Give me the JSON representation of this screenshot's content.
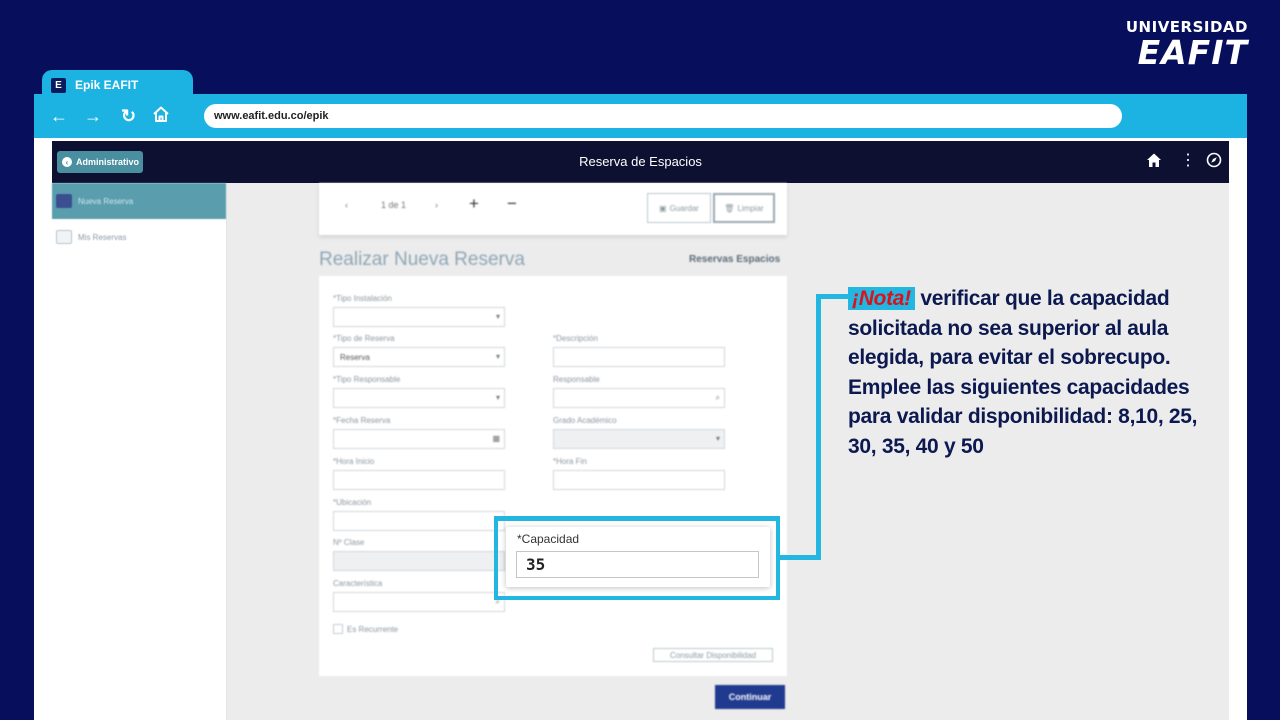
{
  "logo": {
    "line1": "UNIVERSIDAD",
    "line2": "EAFIT"
  },
  "browser": {
    "tab_title": "Epik EAFIT",
    "favicon_letter": "E",
    "url": "www.eafit.edu.co/epik"
  },
  "app": {
    "back_label": "Administrativo",
    "title": "Reserva de Espacios"
  },
  "sidebar": {
    "items": [
      {
        "label": "Nueva Reserva"
      },
      {
        "label": "Mis Reservas"
      }
    ]
  },
  "pager": {
    "page_text": "1 de 1",
    "save_label": "Guardar",
    "clear_label": "Limpiar"
  },
  "form": {
    "title": "Realizar Nueva Reserva",
    "link": "Reservas Espacios",
    "fields": {
      "tipo_instalacion": {
        "label": "*Tipo Instalación",
        "value": ""
      },
      "tipo_reserva": {
        "label": "*Tipo de Reserva",
        "value": "Reserva"
      },
      "descripcion": {
        "label": "*Descripción",
        "value": ""
      },
      "tipo_responsable": {
        "label": "*Tipo Responsable",
        "value": ""
      },
      "responsable": {
        "label": "Responsable",
        "value": ""
      },
      "fecha_reserva": {
        "label": "*Fecha Reserva",
        "value": ""
      },
      "grado_academico": {
        "label": "Grado Académico",
        "value": ""
      },
      "hora_inicio": {
        "label": "*Hora Inicio",
        "value": ""
      },
      "hora_fin": {
        "label": "*Hora Fin",
        "value": ""
      },
      "ubicacion": {
        "label": "*Ubicación",
        "value": ""
      },
      "n_clase": {
        "label": "Nº Clase",
        "value": ""
      },
      "caracteristica": {
        "label": "Característica",
        "value": ""
      }
    },
    "recurrente_label": "Es Recurrente",
    "consult_label": "Consultar Disponibilidad",
    "continue_label": "Continuar"
  },
  "capacidad": {
    "label": "*Capacidad",
    "value": "35"
  },
  "note": {
    "tag": "¡Nota!",
    "text": " verificar que la capacidad solicitada no sea superior al aula elegida, para evitar el sobrecupo. Emplee las siguientes capacidades para validar disponibilidad: 8,10, 25, 30, 35, 40 y 50"
  },
  "colors": {
    "background": "#070f5c",
    "accent": "#1cb3e3",
    "app_header": "#0d1030",
    "note_text": "#0c1950",
    "note_tag": "#d9131e",
    "primary_button": "#1f3a8f"
  }
}
